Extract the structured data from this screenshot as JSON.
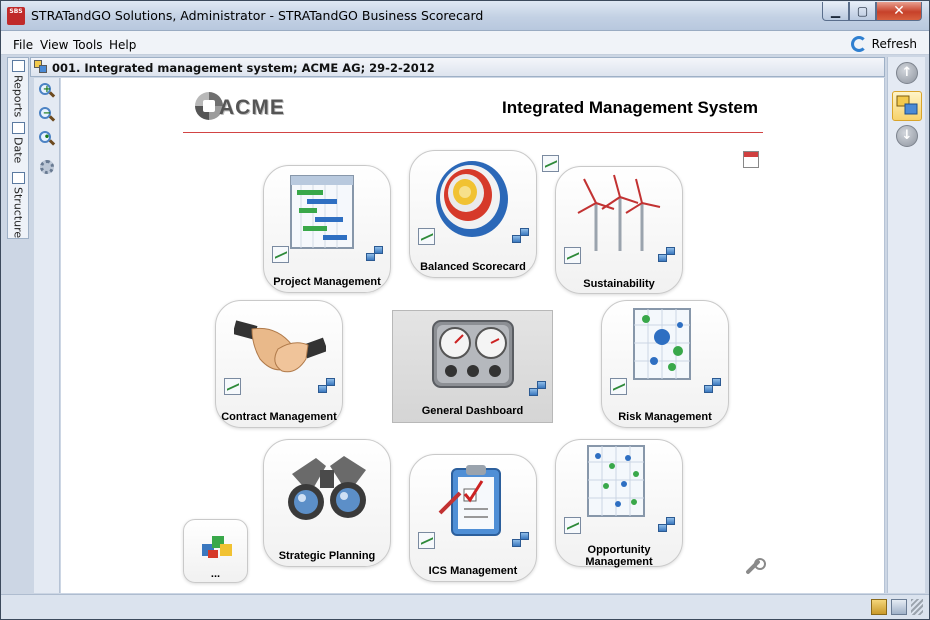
{
  "window": {
    "app_icon_text": "SBS",
    "title": "STRATandGO Solutions, Administrator - STRATandGO Business Scorecard",
    "controls": {
      "minimize": "▁",
      "maximize": "▢",
      "close": "✕"
    }
  },
  "menu": {
    "items": [
      "File",
      "View",
      "Tools",
      "Help"
    ],
    "refresh_label": "Refresh"
  },
  "side_tabs": [
    "Reports",
    "Date",
    "Structure"
  ],
  "document": {
    "title": "001. Integrated management system; ACME AG; 29-2-2012"
  },
  "page": {
    "logo_text": "ACME",
    "title": "Integrated Management System"
  },
  "tiles": {
    "project_management": "Project Management",
    "balanced_scorecard": "Balanced Scorecard",
    "sustainability": "Sustainability",
    "contract_management": "Contract Management",
    "general_dashboard": "General Dashboard",
    "risk_management": "Risk Management",
    "strategic_planning": "Strategic Planning",
    "ics_management": "ICS Management",
    "opportunity_management": "Opportunity Management",
    "more": "..."
  },
  "colors": {
    "accent_red": "#d24444",
    "title_bar": "#c3d1e4",
    "close_button": "#c7412a"
  }
}
